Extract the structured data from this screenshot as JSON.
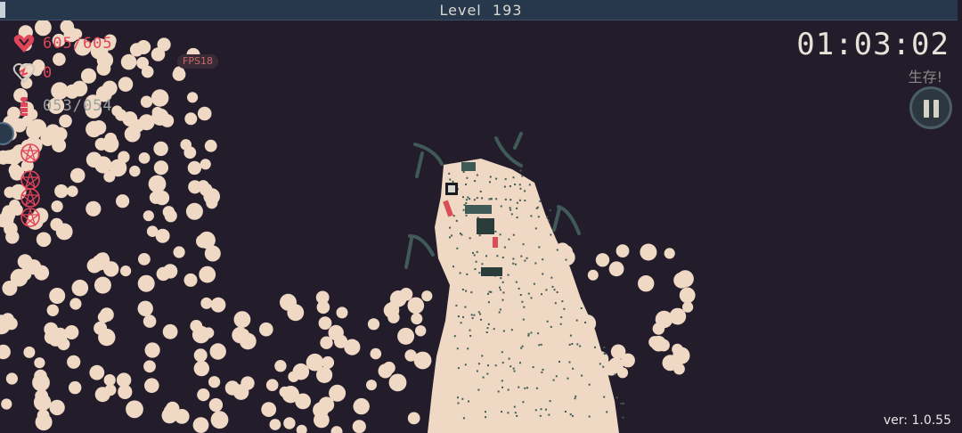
{
  "header": {
    "level_label": "Level",
    "level_value": "193"
  },
  "stats": {
    "hp": {
      "icon": "heart-icon",
      "text": "605/605",
      "color": "#e0455a"
    },
    "kills": {
      "icon": "broken-heart-icon",
      "text": "0",
      "color": "#e0455a"
    },
    "ammo": {
      "icon": "bullet-icon",
      "text": "053/054",
      "color": "#9aa3a0"
    }
  },
  "fps_badge": "FPS18",
  "timer": "01:03:02",
  "survive_label": "生存!",
  "version": "ver: 1.0.55",
  "colors": {
    "background": "#231c2b",
    "enemy_blob": "#efd9c5",
    "accent_red": "#e0455a",
    "topbar": "#27384c"
  }
}
